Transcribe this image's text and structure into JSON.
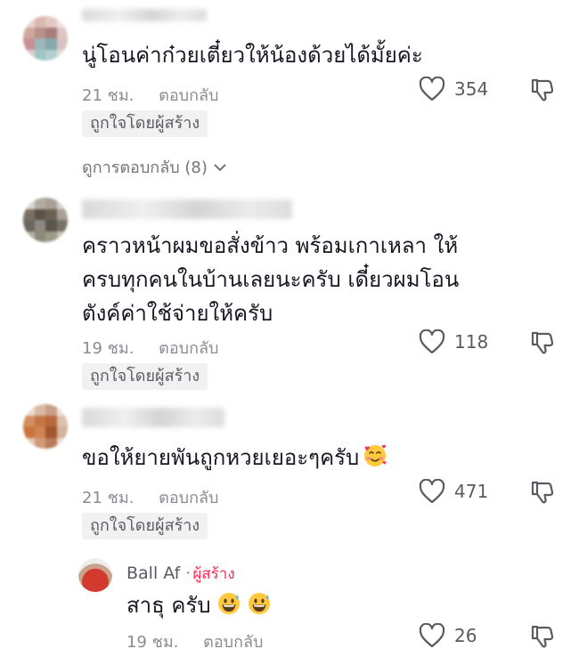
{
  "comments": [
    {
      "text": "นู่โอนค่าก๋วยเตี๋ยวให้น้องด้วยได้มั้ยค่ะ",
      "time": "21 ชม.",
      "reply_label": "ตอบกลับ",
      "likes": "354",
      "liked_by_creator": "ถูกใจโดยผู้สร้าง",
      "view_replies": "ดูการตอบกลับ (8)"
    },
    {
      "lines": [
        "คราวหน้าผมขอสั่งข้าว พร้อมเกาเหลา ให้",
        "ครบทุกคนในบ้านเลยนะครับ เดี๋ยวผมโอน",
        "ตังค์ค่าใช้จ่ายให้ครับ"
      ],
      "time": "19 ชม.",
      "reply_label": "ตอบกลับ",
      "likes": "118",
      "liked_by_creator": "ถูกใจโดยผู้สร้าง"
    },
    {
      "text": "ขอให้ยายพันถูกหวยเยอะๆครับ",
      "emoji": "smiling-face-with-hearts",
      "time": "21 ชม.",
      "reply_label": "ตอบกลับ",
      "likes": "471",
      "liked_by_creator": "ถูกใจโดยผู้สร้าง"
    }
  ],
  "reply": {
    "username": "Ball Af",
    "separator": "·",
    "creator_badge": "ผู้สร้าง",
    "text": "สาธุ ครับ",
    "emojis": [
      "grinning-face-with-sweat",
      "grinning-face-with-sweat"
    ],
    "time": "19 ชม.",
    "reply_label": "ตอบกลับ",
    "likes": "26"
  },
  "colors": {
    "text": "#161823",
    "meta": "#8a8b91",
    "creator_accent": "#fe2c55",
    "tag_bg": "#f1f1f2"
  }
}
